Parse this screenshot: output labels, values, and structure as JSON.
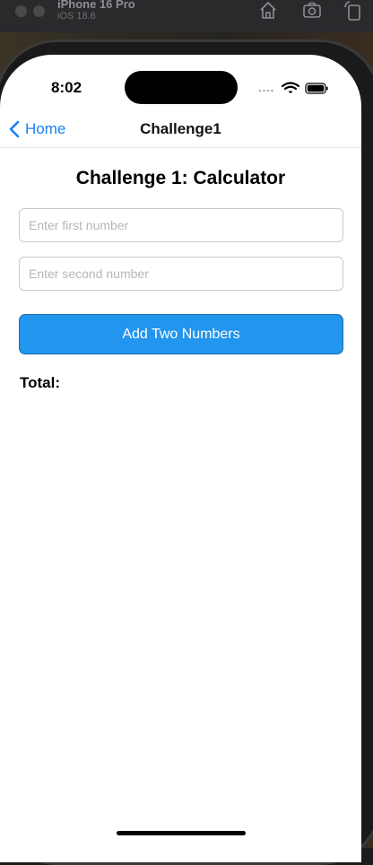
{
  "simulator": {
    "device_name": "iPhone 16 Pro",
    "os_version": "iOS 18.6",
    "buttons": [
      "home-icon",
      "screenshot-icon",
      "rotate-icon"
    ]
  },
  "status_bar": {
    "time": "8:02",
    "icons": [
      "signal-dots-icon",
      "wifi-icon",
      "battery-icon"
    ]
  },
  "nav": {
    "back_label": "Home",
    "title": "Challenge1"
  },
  "page": {
    "title": "Challenge 1: Calculator"
  },
  "form": {
    "first_number": {
      "value": "",
      "placeholder": "Enter first number"
    },
    "second_number": {
      "value": "",
      "placeholder": "Enter second number"
    },
    "add_button_label": "Add Two Numbers",
    "total_label": "Total:"
  },
  "colors": {
    "accent": "#1a7ff5",
    "button_bg": "#2295ee",
    "button_border": "#1e6db0"
  }
}
